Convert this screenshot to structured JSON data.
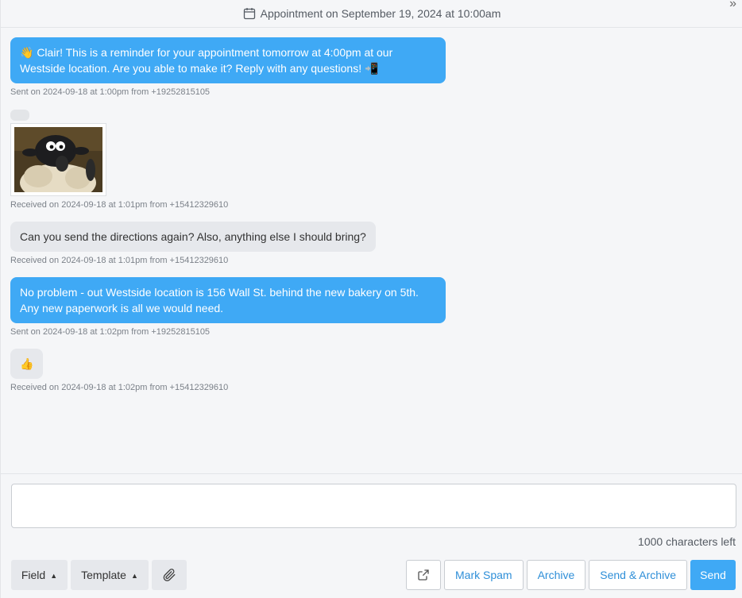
{
  "header": {
    "title": "Appointment on September 19, 2024 at  10:00am"
  },
  "messages": [
    {
      "direction": "sent",
      "text": "👋 Clair! This is a reminder for your appointment tomorrow at 4:00pm at our Westside location. Are you able to make it? Reply with any questions! 📲",
      "meta": "Sent on 2024-09-18 at 1:00pm from +19252815105"
    },
    {
      "direction": "received",
      "attachment": "image",
      "meta": "Received on 2024-09-18 at 1:01pm from +15412329610"
    },
    {
      "direction": "received",
      "text": "Can you send the directions again? Also, anything else I should bring?",
      "meta": "Received on 2024-09-18 at 1:01pm from +15412329610"
    },
    {
      "direction": "sent",
      "text": "No problem - out Westside location is 156 Wall St. behind the new bakery on 5th. Any new paperwork is all we would need.",
      "meta": "Sent on 2024-09-18 at 1:02pm from +19252815105"
    },
    {
      "direction": "received",
      "text": "👍",
      "meta": "Received on 2024-09-18 at 1:02pm from +15412329610"
    }
  ],
  "composer": {
    "value": "",
    "placeholder": "",
    "chars_left": "1000 characters left"
  },
  "toolbar": {
    "field_label": "Field",
    "template_label": "Template",
    "mark_spam_label": "Mark Spam",
    "archive_label": "Archive",
    "send_archive_label": "Send & Archive",
    "send_label": "Send"
  },
  "colors": {
    "sent_bubble": "#3fa9f5",
    "received_bubble": "#e6e8ec",
    "accent": "#3fa9f5"
  }
}
